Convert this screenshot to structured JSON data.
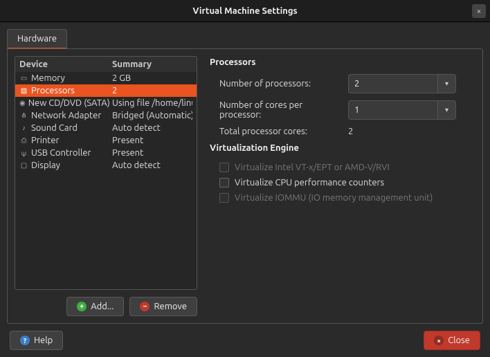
{
  "window": {
    "title": "Virtual Machine Settings",
    "close_icon": "×"
  },
  "tabs": {
    "hardware": "Hardware"
  },
  "device_table": {
    "head_device": "Device",
    "head_summary": "Summary",
    "rows": [
      {
        "icon": "memory-icon",
        "glyph": "▭",
        "name": "Memory",
        "summary": "2 GB",
        "selected": false
      },
      {
        "icon": "processor-icon",
        "glyph": "▧",
        "name": "Processors",
        "summary": "2",
        "selected": true
      },
      {
        "icon": "disc-icon",
        "glyph": "◉",
        "name": "New CD/DVD (SATA)",
        "summary": "Using file /home/linuxte",
        "selected": false
      },
      {
        "icon": "network-icon",
        "glyph": "⋔",
        "name": "Network Adapter",
        "summary": "Bridged (Automatic)",
        "selected": false
      },
      {
        "icon": "sound-icon",
        "glyph": "♪",
        "name": "Sound Card",
        "summary": "Auto detect",
        "selected": false
      },
      {
        "icon": "printer-icon",
        "glyph": "⎙",
        "name": "Printer",
        "summary": "Present",
        "selected": false
      },
      {
        "icon": "usb-icon",
        "glyph": "ψ",
        "name": "USB Controller",
        "summary": "Present",
        "selected": false
      },
      {
        "icon": "display-icon",
        "glyph": "▢",
        "name": "Display",
        "summary": "Auto detect",
        "selected": false
      }
    ]
  },
  "buttons": {
    "add": "Add...",
    "remove": "Remove",
    "help": "Help",
    "close": "Close"
  },
  "processors": {
    "title": "Processors",
    "num_label": "Number of processors:",
    "num_value": "2",
    "cores_label": "Number of cores per processor:",
    "cores_value": "1",
    "total_label": "Total processor cores:",
    "total_value": "2"
  },
  "virt": {
    "title": "Virtualization Engine",
    "opt1": "Virtualize Intel VT-x/EPT or AMD-V/RVI",
    "opt2": "Virtualize CPU performance counters",
    "opt3": "Virtualize IOMMU (IO memory management unit)"
  }
}
